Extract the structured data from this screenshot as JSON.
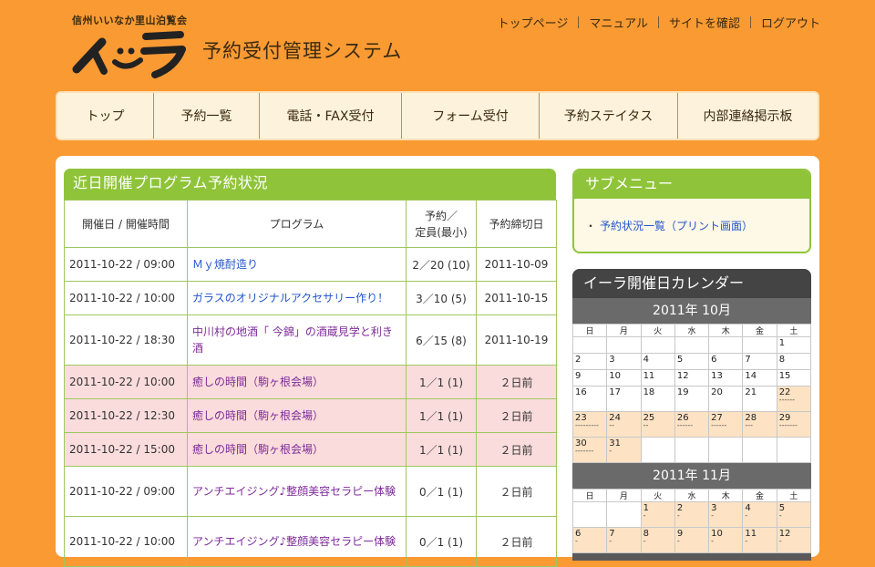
{
  "header": {
    "org": "信州いいなか里山泊覧会",
    "logo_text": "イーラ",
    "system_title": "予約受付管理システム",
    "links": [
      "トップページ",
      "マニュアル",
      "サイトを確認",
      "ログアウト"
    ]
  },
  "nav": [
    "トップ",
    "予約一覧",
    "電話・FAX受付",
    "フォーム受付",
    "予約ステイタス",
    "内部連絡掲示板"
  ],
  "main": {
    "title": "近日開催プログラム予約状況",
    "columns": [
      "開催日 / 開催時間",
      "プログラム",
      "予約／\n定員(最小)",
      "予約締切日"
    ],
    "rows": [
      {
        "datetime": "2011-10-22 / 09:00",
        "program": "Ｍｙ焼酎造り",
        "count": "2／20 (10)",
        "deadline": "2011-10-09"
      },
      {
        "datetime": "2011-10-22 / 10:00",
        "program": "ガラスのオリジナルアクセサリー作り！",
        "count": "3／10 (5)",
        "deadline": "2011-10-15"
      },
      {
        "datetime": "2011-10-22 / 18:30",
        "program": "中川村の地酒「 今錦」の酒蔵見学と利き酒",
        "count": "6／15 (8)",
        "deadline": "2011-10-19"
      },
      {
        "datetime": "2011-10-22 / 10:00",
        "program": "癒しの時間（駒ヶ根会場）",
        "count": "1／1 (1)",
        "deadline": "２日前"
      },
      {
        "datetime": "2011-10-22 / 12:30",
        "program": "癒しの時間（駒ヶ根会場）",
        "count": "1／1 (1)",
        "deadline": "２日前"
      },
      {
        "datetime": "2011-10-22 / 15:00",
        "program": "癒しの時間（駒ヶ根会場）",
        "count": "1／1 (1)",
        "deadline": "２日前"
      },
      {
        "datetime": "2011-10-22 / 09:00",
        "program": "アンチエイジング♪整顔美容セラピー体験",
        "count": "0／1 (1)",
        "deadline": "２日前"
      },
      {
        "datetime": "2011-10-22 / 10:00",
        "program": "アンチエイジング♪整顔美容セラピー体験",
        "count": "0／1 (1)",
        "deadline": "２日前"
      }
    ]
  },
  "submenu": {
    "title": "サブメニュー",
    "link": "予約状況一覧（プリント画面）"
  },
  "calendar": {
    "title": "イーラ開催日カレンダー",
    "weekdays": [
      "日",
      "月",
      "火",
      "水",
      "木",
      "金",
      "土"
    ],
    "oct_label": "2011年 10月",
    "nov_label": "2011年 11月"
  },
  "colors": {
    "background": "#f99a33",
    "accent_green": "#8fc43a",
    "pink_row": "#fbdcdc",
    "calendar_open": "#fde3c4"
  }
}
